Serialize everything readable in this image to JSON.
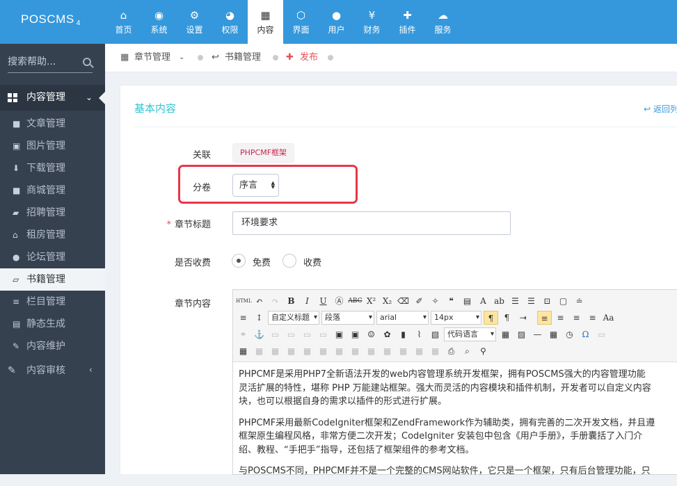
{
  "app": {
    "logo": "POSCMS",
    "logo_version": "4"
  },
  "topnav": [
    {
      "icon": "home-icon",
      "glyph": "⌂",
      "label": "首页"
    },
    {
      "icon": "globe-icon",
      "glyph": "◉",
      "label": "系统"
    },
    {
      "icon": "cogs-icon",
      "glyph": "⚙",
      "label": "设置"
    },
    {
      "icon": "user-circle-icon",
      "glyph": "◕",
      "label": "权限"
    },
    {
      "icon": "grid-icon",
      "glyph": "▦",
      "label": "内容"
    },
    {
      "icon": "html5-icon",
      "glyph": "⬡",
      "label": "界面"
    },
    {
      "icon": "user-icon",
      "glyph": "●",
      "label": "用户"
    },
    {
      "icon": "yen-icon",
      "glyph": "¥",
      "label": "财务"
    },
    {
      "icon": "puzzle-icon",
      "glyph": "✚",
      "label": "插件"
    },
    {
      "icon": "cloud-icon",
      "glyph": "☁",
      "label": "服务"
    }
  ],
  "topnav_active": "内容",
  "sidebar": {
    "search_placeholder": "搜索帮助...",
    "group": "内容管理",
    "items": [
      {
        "icon": "file-icon",
        "glyph": "■",
        "label": "文章管理"
      },
      {
        "icon": "image-icon",
        "glyph": "▣",
        "label": "图片管理"
      },
      {
        "icon": "download-icon",
        "glyph": "⬇",
        "label": "下载管理"
      },
      {
        "icon": "shop-icon",
        "glyph": "■",
        "label": "商城管理"
      },
      {
        "icon": "briefcase-icon",
        "glyph": "▰",
        "label": "招聘管理"
      },
      {
        "icon": "house-icon",
        "glyph": "⌂",
        "label": "租房管理"
      },
      {
        "icon": "comments-icon",
        "glyph": "●",
        "label": "论坛管理"
      },
      {
        "icon": "book-icon",
        "glyph": "▱",
        "label": "书籍管理"
      },
      {
        "icon": "list-icon",
        "glyph": "≡",
        "label": "栏目管理"
      },
      {
        "icon": "static-icon",
        "glyph": "▤",
        "label": "静态生成"
      },
      {
        "icon": "wrench-icon",
        "glyph": "✎",
        "label": "内容维护"
      }
    ],
    "active_item": "书籍管理",
    "collapsed_group": "内容审核"
  },
  "breadcrumb": {
    "chapter": "章节管理",
    "books": "书籍管理",
    "publish": "发布"
  },
  "form": {
    "section_title": "基本内容",
    "back_label": "返回列",
    "relation_label": "关联",
    "relation_value": "PHPCMF框架",
    "volume_label": "分卷",
    "volume_value": "序言",
    "title_label": "章节标题",
    "title_value": "环境要求",
    "charge_label": "是否收费",
    "charge_options": [
      "免费",
      "收费"
    ],
    "charge_selected": "免费",
    "content_label": "章节内容"
  },
  "editor": {
    "combos": {
      "title": "自定义标题",
      "paragraph": "段落",
      "font": "arial",
      "size": "14px",
      "code": "代码语言"
    },
    "paragraphs": [
      "PHPCMF是采用PHP7全新语法开发的web内容管理系统开发框架，拥有POSCMS强大的内容管理功能",
      "灵活扩展的特性，堪称 PHP 万能建站框架。强大而灵活的内容模块和插件机制，开发者可以自定义内容",
      "块，也可以根据自身的需求以插件的形式进行扩展。",
      "PHPCMF采用最新CodeIgniter框架和ZendFramework作为辅助类，拥有完善的二次开发文档，并且遵",
      "框架原生编程风格，非常方便二次开发；CodeIgniter 安装包中包含《用户手册》，手册囊括了入门介",
      "绍、教程、“手把手”指导，还包括了框架组件的参考文档。",
      "与POSCMS不同，PHPCMF并不是一个完整的CMS网站软件，它只是一个框架，只有后台管理功能，只"
    ]
  }
}
